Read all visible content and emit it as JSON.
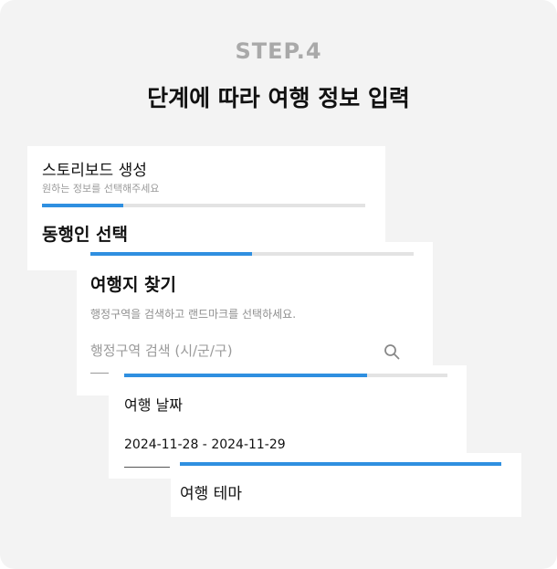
{
  "header": {
    "step": "STEP.4",
    "headline": "단계에 따라 여행 정보 입력"
  },
  "cards": {
    "storyboard": {
      "title": "스토리보드 생성",
      "subtitle": "원하는 정보를 선택해주세요",
      "progress": 0.25,
      "next_title": "동행인 선택"
    },
    "destination": {
      "progress": 0.5,
      "title": "여행지 찾기",
      "description": "행정구역을 검색하고 랜드마크를 선택하세요.",
      "search_placeholder": "행정구역 검색 (시/군/구)",
      "search_icon": "search-icon"
    },
    "dates": {
      "progress": 0.75,
      "title": "여행 날짜",
      "value": "2024-11-28 - 2024-11-29"
    },
    "theme": {
      "progress": 1.0,
      "title": "여행 테마"
    }
  },
  "colors": {
    "background": "#f3f3f3",
    "accent": "#2f8fe0",
    "track": "#e3e3e3",
    "step_label": "#a9a9a9"
  }
}
